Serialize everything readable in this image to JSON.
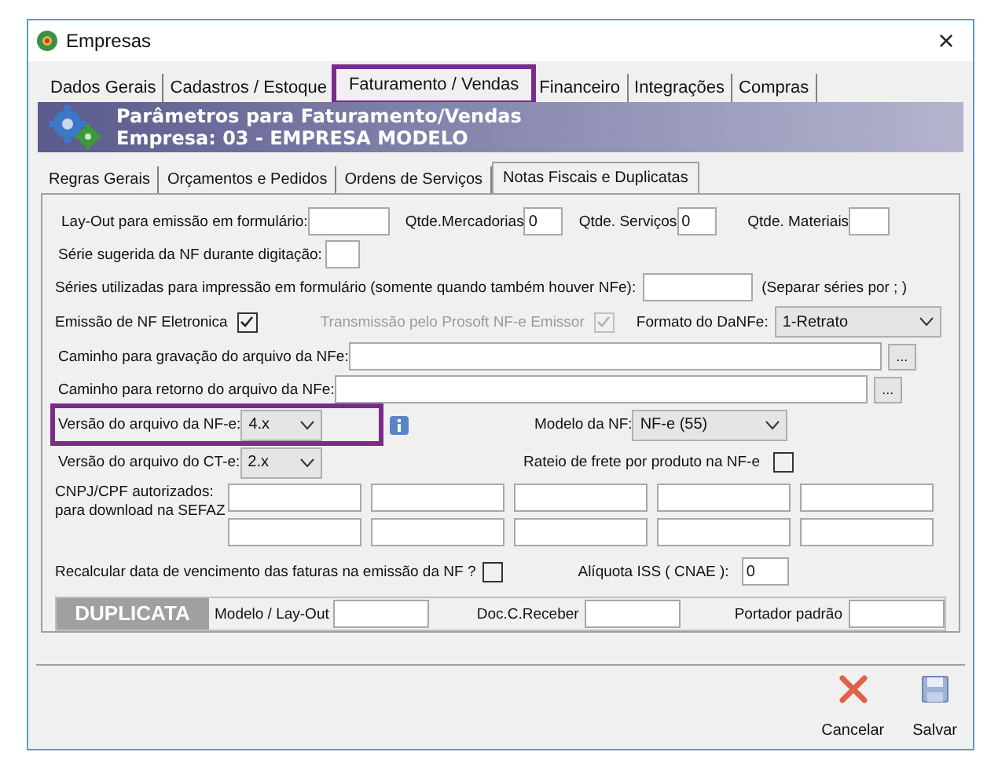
{
  "window": {
    "title": "Empresas",
    "close": "×"
  },
  "tabs": [
    {
      "label": "Dados Gerais",
      "selected": false,
      "highlighted": false
    },
    {
      "label": "Cadastros / Estoque",
      "selected": false,
      "highlighted": false
    },
    {
      "label": "Faturamento / Vendas",
      "selected": true,
      "highlighted": true
    },
    {
      "label": "Financeiro",
      "selected": false,
      "highlighted": false
    },
    {
      "label": "Integrações",
      "selected": false,
      "highlighted": false
    },
    {
      "label": "Compras",
      "selected": false,
      "highlighted": false
    }
  ],
  "header": {
    "title": "Parâmetros para Faturamento/Vendas",
    "subtitle": "Empresa: 03 - EMPRESA MODELO"
  },
  "subtabs": [
    {
      "label": "Regras Gerais",
      "selected": false
    },
    {
      "label": "Orçamentos e Pedidos",
      "selected": false
    },
    {
      "label": "Ordens de Serviços",
      "selected": false
    },
    {
      "label": "Notas Fiscais e Duplicatas",
      "selected": true
    }
  ],
  "form": {
    "layout": {
      "label": "Lay-Out para emissão em formulário:"
    },
    "qtde_mercadorias": {
      "label": "Qtde.Mercadorias",
      "value": "0"
    },
    "qtde_servicos": {
      "label": "Qtde. Serviços",
      "value": "0"
    },
    "qtde_materiais": {
      "label": "Qtde. Materiais"
    },
    "serie_sugerida": {
      "label": "Série sugerida da NF durante digitação:"
    },
    "series_utilizadas": {
      "label": "Séries utilizadas para impressão em formulário (somente quando também houver NFe):",
      "hint": "(Separar séries por ; )"
    },
    "emissao_nfe": {
      "label": "Emissão de NF Eletronica",
      "checked": true,
      "disabled": false
    },
    "transmissao": {
      "label": "Transmissão pelo Prosoft NF-e Emissor",
      "checked": true,
      "disabled": true
    },
    "formato_danfe": {
      "label": "Formato do DaNFe:",
      "value": "1-Retrato"
    },
    "caminho_gravacao": {
      "label": "Caminho para gravação do arquivo da NFe:",
      "button": "..."
    },
    "caminho_retorno": {
      "label": "Caminho para retorno do arquivo da NFe:",
      "button": "..."
    },
    "versao_nfe": {
      "label": "Versão do arquivo da NF-e:",
      "value": "4.x",
      "highlighted": true
    },
    "modelo_nf": {
      "label": "Modelo da NF:",
      "value": "NF-e (55)"
    },
    "versao_cte": {
      "label": "Versão do arquivo do CT-e:",
      "value": "2.x",
      "highlighted": false
    },
    "rateio_frete": {
      "label": "Rateio de frete por produto na NF-e",
      "checked": false,
      "disabled": false
    },
    "cnpj": {
      "label": "CNPJ/CPF autorizados: para download na SEFAZ"
    },
    "recalcular": {
      "label": "Recalcular data de vencimento das faturas na emissão da NF ?",
      "checked": false,
      "disabled": false
    },
    "aliquota_iss": {
      "label": "Alíquota ISS ( CNAE ):",
      "value": "0"
    }
  },
  "duplicata": {
    "title": "DUPLICATA",
    "fields": [
      {
        "label": "Modelo / Lay-Out"
      },
      {
        "label": "Doc.C.Receber"
      },
      {
        "label": "Portador padrão"
      }
    ]
  },
  "buttons": [
    {
      "kind": "cancel",
      "label": "Cancelar"
    },
    {
      "kind": "save",
      "label": "Salvar"
    }
  ]
}
